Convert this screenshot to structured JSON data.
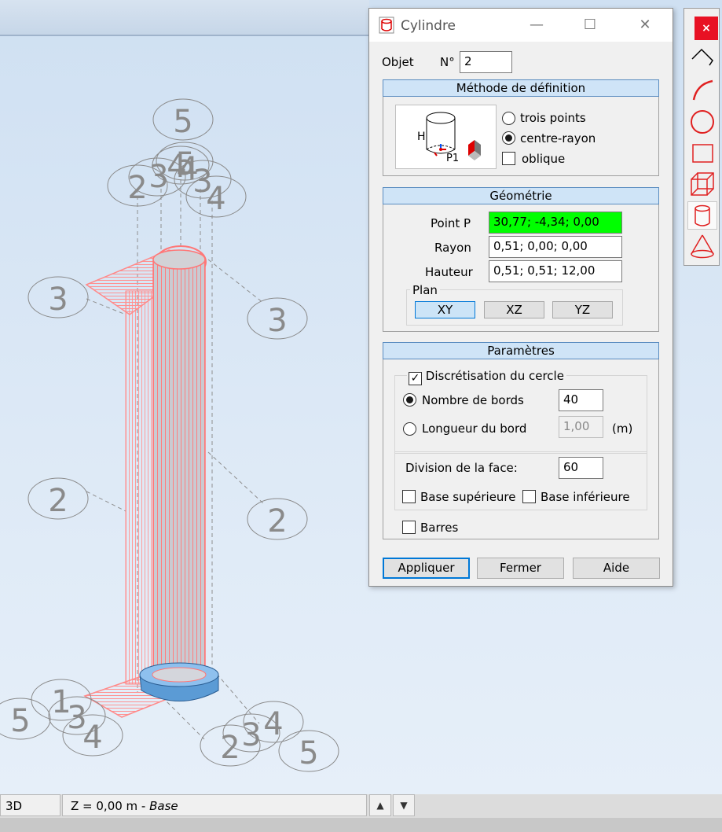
{
  "dialog": {
    "title": "Cylindre",
    "objet_label": "Objet",
    "no_label": "N°",
    "no_value": "2",
    "methode": {
      "header": "Méthode de définition",
      "options": [
        "trois points",
        "centre-rayon"
      ],
      "selected": "centre-rayon",
      "oblique_label": "oblique",
      "oblique_checked": false,
      "preview_labels": [
        "H",
        "P1"
      ]
    },
    "geometrie": {
      "header": "Géométrie",
      "point_label": "Point P",
      "point_value": "30,77; -4,34; 0,00",
      "rayon_label": "Rayon",
      "rayon_value": "0,51; 0,00; 0,00",
      "hauteur_label": "Hauteur",
      "hauteur_value": "0,51; 0,51; 12,00",
      "plan_label": "Plan",
      "plan_buttons": [
        "XY",
        "XZ",
        "YZ"
      ],
      "plan_selected": "XY"
    },
    "parametres": {
      "header": "Paramètres",
      "discretisation_label": "Discrétisation du cercle",
      "discretisation_checked": true,
      "nombre_label": "Nombre de bords",
      "nombre_value": "40",
      "longueur_label": "Longueur du bord",
      "longueur_value": "1,00",
      "unit": "(m)",
      "division_label": "Division de la face:",
      "division_value": "60",
      "base_sup_label": "Base supérieure",
      "base_inf_label": "Base inférieure",
      "barres_label": "Barres"
    },
    "buttons": {
      "apply": "Appliquer",
      "close": "Fermer",
      "help": "Aide"
    }
  },
  "toolbar": {
    "close": "×",
    "tools": [
      "polyline-icon",
      "arc-icon",
      "circle-icon",
      "rectangle-icon",
      "box-icon",
      "cylinder-icon",
      "cone-icon"
    ],
    "active": "cylinder-icon"
  },
  "statusbar": {
    "view": "3D",
    "level_prefix": "Z = 0,00 m - ",
    "level_name": "Base",
    "up_arrow": "▲",
    "down_arrow": "▼"
  },
  "scene": {
    "top_labels": [
      "5",
      "2",
      "3",
      "4",
      "5",
      "4",
      "3",
      "4"
    ],
    "side_labels": [
      "3",
      "3",
      "2",
      "2"
    ],
    "bottom_labels": [
      "5",
      "1",
      "3",
      "2",
      "4",
      "2",
      "3",
      "4",
      "5"
    ],
    "colors": {
      "cylinder_mesh": "#ff8a8a",
      "base": "#5b9bd5",
      "background": "#dde9f6"
    }
  }
}
